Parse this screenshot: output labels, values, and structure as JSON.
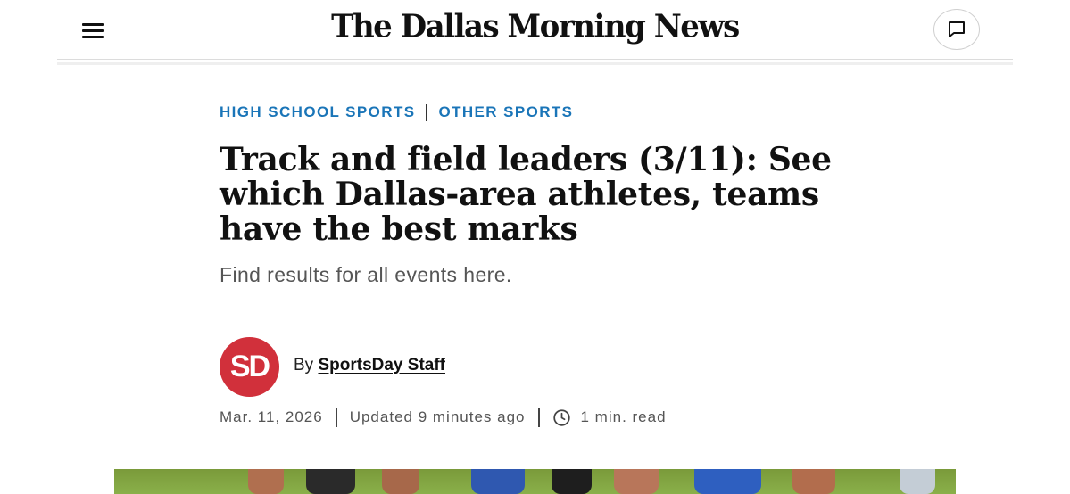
{
  "header": {
    "logo_text": "The Dallas Morning News",
    "menu_icon": "hamburger-menu-icon",
    "comments_icon": "comment-bubble-icon"
  },
  "article": {
    "sections": [
      "HIGH SCHOOL SPORTS",
      "OTHER SPORTS"
    ],
    "headline": "Track and field leaders (3/11): See which Dallas-area athletes, teams have the best marks",
    "subheadline": "Find results for all events here.",
    "author": {
      "avatar_text": "SD",
      "by_label": "By",
      "name": "SportsDay Staff"
    },
    "meta": {
      "date": "Mar. 11, 2026",
      "updated": "Updated 9 minutes ago",
      "read_time": "1 min. read",
      "clock_icon": "clock-icon"
    }
  },
  "colors": {
    "section_link": "#1a75b8",
    "avatar_bg": "#d1303b",
    "text_primary": "#111111",
    "text_muted": "#555555"
  }
}
